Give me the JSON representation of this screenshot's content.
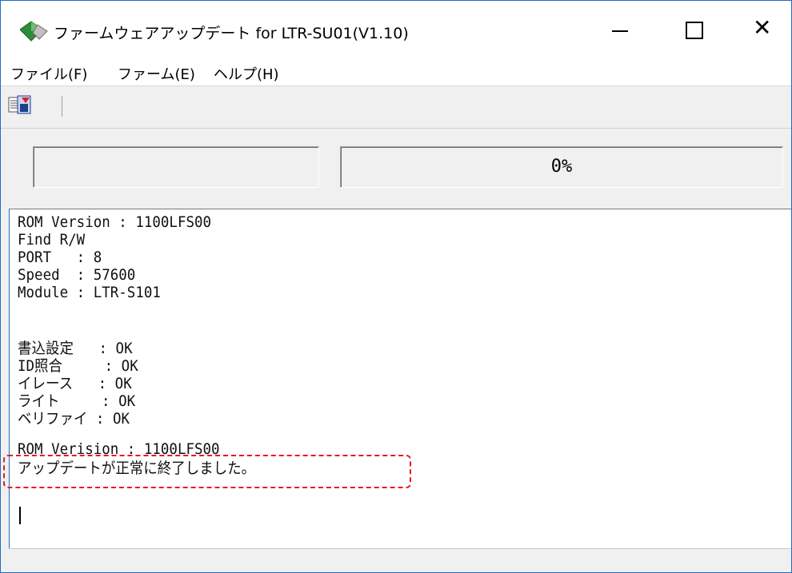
{
  "window": {
    "title": "ファームウェアアップデート for LTR-SU01(V1.10)",
    "icon": "diamond-app-icon",
    "controls": {
      "minimize": "—",
      "maximize": "",
      "close": "✕"
    }
  },
  "menu": {
    "items": [
      "ファイル(F)",
      "ファーム(E)",
      "ヘルプ(H)"
    ]
  },
  "toolbar": {
    "buttons": [
      "firmware-write-icon"
    ]
  },
  "progress": {
    "left_text": "",
    "right_text": "0%"
  },
  "log": {
    "lines": [
      "ROM Version : 1100LFS00",
      "Find R/W",
      "PORT   : 8",
      "Speed  : 57600",
      "Module : LTR-S101",
      "",
      "書込設定   : OK",
      "ID照合     : OK",
      "イレース   : OK",
      "ライト     : OK",
      "ベリファイ : OK",
      "ROM Verision : 1100LFS00",
      "アップデートが正常に終了しました。"
    ]
  },
  "colors": {
    "accent": "#1f6fc4",
    "highlight": "#e11d1d"
  }
}
